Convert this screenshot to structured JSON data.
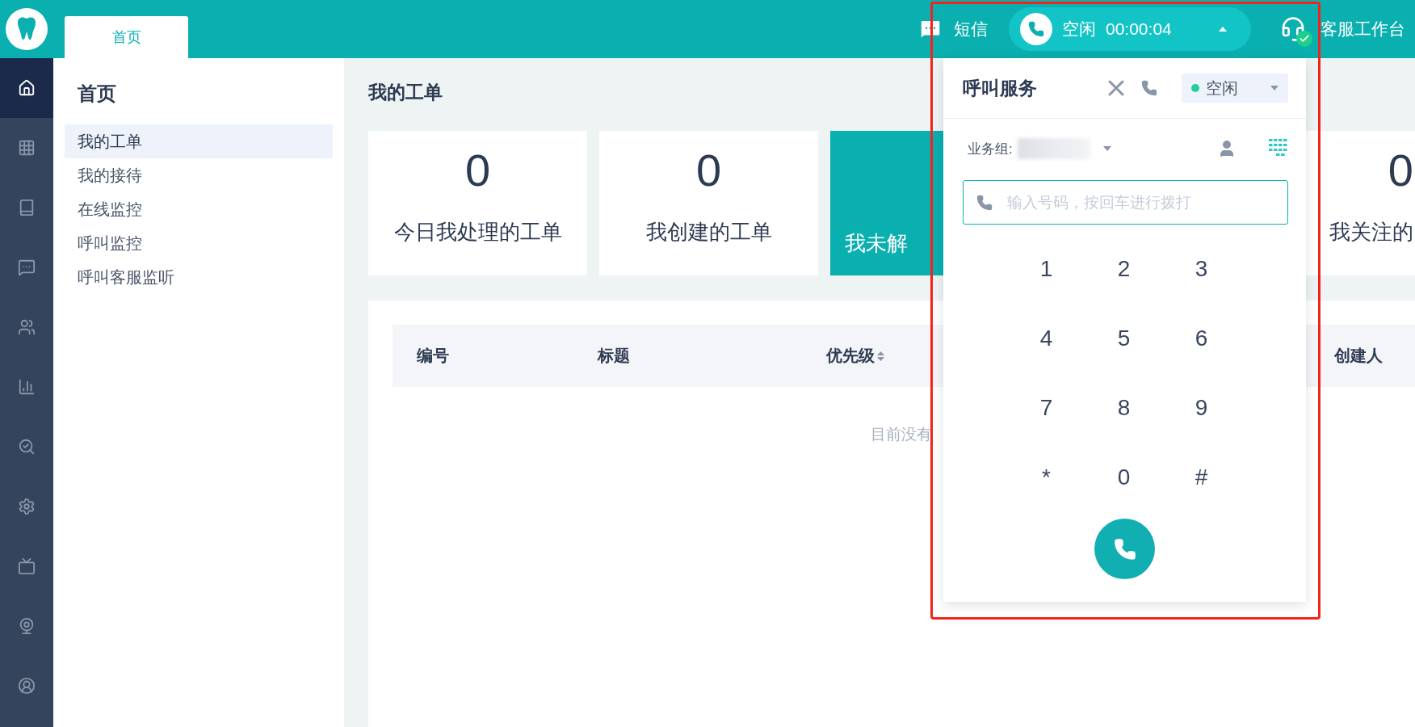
{
  "app_tab": {
    "label": "首页",
    "selected": true
  },
  "rail": [
    {
      "kind": "home",
      "selected": true
    },
    {
      "kind": "grid",
      "selected": false
    },
    {
      "kind": "book",
      "selected": false
    },
    {
      "kind": "chat",
      "selected": false
    },
    {
      "kind": "users",
      "selected": false
    },
    {
      "kind": "chart",
      "selected": false
    },
    {
      "kind": "search",
      "selected": false
    },
    {
      "kind": "settings",
      "selected": false
    },
    {
      "kind": "tv",
      "selected": false
    },
    {
      "kind": "camera",
      "selected": false
    },
    {
      "kind": "user",
      "selected": false
    }
  ],
  "top_bar": {
    "sms": "短信",
    "call_state": "空闲",
    "call_timer": "00:00:04",
    "workbench": "客服工作台",
    "online": true
  },
  "nav": {
    "title": "首页",
    "items": [
      {
        "label": "我的工单",
        "selected": true
      },
      {
        "label": "我的接待",
        "selected": false
      },
      {
        "label": "在线监控",
        "selected": false
      },
      {
        "label": "呼叫监控",
        "selected": false
      },
      {
        "label": "呼叫客服监听",
        "selected": false
      }
    ]
  },
  "main": {
    "title": "我的工单",
    "cards": [
      {
        "kind": "full",
        "count": "0",
        "label": "今日我处理的工单",
        "selected": false
      },
      {
        "kind": "full",
        "count": "0",
        "label": "我创建的工单",
        "selected": false
      },
      {
        "kind": "covered",
        "label": "我未解",
        "selected": true
      },
      {
        "kind": "edge",
        "count": "0",
        "label": "我关注的",
        "selected": false
      }
    ],
    "columns": [
      {
        "label": "编号",
        "sortable": false
      },
      {
        "label": "标题",
        "sortable": false
      },
      {
        "label": "优先级",
        "sortable": true
      },
      {
        "label": "创建人",
        "sortable": false
      }
    ],
    "empty": "目前没有"
  },
  "call_panel": {
    "title": "呼叫服务",
    "status": {
      "label": "空闲",
      "color": "#1ed0a0"
    },
    "group_label": "业务组:",
    "placeholder": "输入号码，按回车进行拨打",
    "keys": [
      "1",
      "2",
      "3",
      "4",
      "5",
      "6",
      "7",
      "8",
      "9",
      "*",
      "0",
      "#"
    ]
  }
}
